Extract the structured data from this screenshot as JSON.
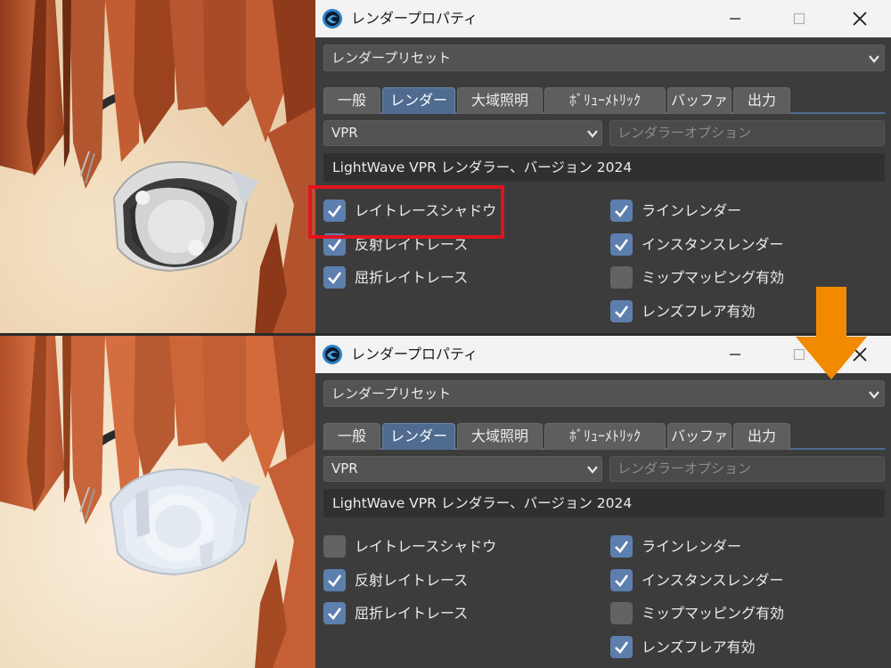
{
  "app": {
    "title": "レンダープロパティ",
    "icon": "lightwave-logo-icon",
    "window_controls": [
      "minimize-icon",
      "maximize-icon",
      "close-icon"
    ]
  },
  "preset": {
    "value": "レンダープリセット"
  },
  "tabs": [
    {
      "label": "一般",
      "active": false
    },
    {
      "label": "レンダー",
      "active": true
    },
    {
      "label": "大域照明",
      "active": false
    },
    {
      "label": "ﾎﾞﾘｭｰﾒﾄﾘｯｸ",
      "active": false
    },
    {
      "label": "バッファ",
      "active": false
    },
    {
      "label": "出力",
      "active": false
    }
  ],
  "renderer_select": {
    "value": "VPR"
  },
  "renderer_options_button": {
    "label": "レンダラーオプション"
  },
  "renderer_info": "LightWave VPR レンダラー、バージョン 2024",
  "top_panel": {
    "checkboxes_left": [
      {
        "label": "レイトレースシャドウ",
        "checked": true
      },
      {
        "label": "反射レイトレース",
        "checked": true
      },
      {
        "label": "屈折レイトレース",
        "checked": true
      }
    ],
    "checkboxes_right": [
      {
        "label": "ラインレンダー",
        "checked": true
      },
      {
        "label": "インスタンスレンダー",
        "checked": true
      },
      {
        "label": "ミップマッピング有効",
        "checked": false
      },
      {
        "label": "レンズフレア有効",
        "checked": true
      }
    ]
  },
  "bottom_panel": {
    "checkboxes_left": [
      {
        "label": "レイトレースシャドウ",
        "checked": false
      },
      {
        "label": "反射レイトレース",
        "checked": true
      },
      {
        "label": "屈折レイトレース",
        "checked": true
      }
    ],
    "checkboxes_right": [
      {
        "label": "ラインレンダー",
        "checked": true
      },
      {
        "label": "インスタンスレンダー",
        "checked": true
      },
      {
        "label": "ミップマッピング有効",
        "checked": false
      },
      {
        "label": "レンズフレア有効",
        "checked": true
      }
    ]
  },
  "colors": {
    "highlight": "#e0141e",
    "arrow": "#f28a00",
    "accent": "#5d7fae",
    "panel_bg": "#3c3c3c",
    "hair": "#b2532d",
    "skin": "#f0dcbc"
  }
}
